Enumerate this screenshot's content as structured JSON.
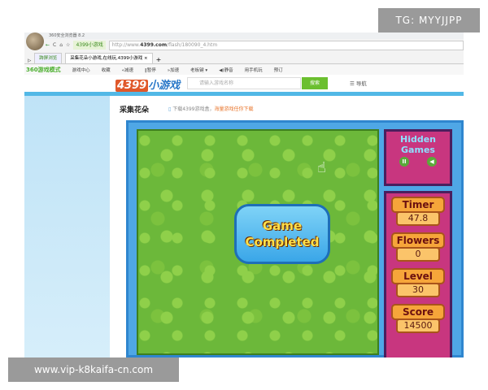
{
  "browser": {
    "title": "360安全浏览器 8.2",
    "url_prefix": "http://www.",
    "url_domain": "4399.com",
    "url_path": "/flash/180090_4.htm",
    "site_badge": "4399小游戏",
    "tabs": [
      {
        "label": "跨屏浏览"
      },
      {
        "label": "采集花朵小游戏,在线玩,4399小游戏 ×"
      },
      {
        "label": "+"
      }
    ],
    "toolbar": [
      "360游戏模式",
      "游戏中心",
      "收藏",
      "«减速",
      "‖暂停",
      "»加速",
      "老板键 ▾",
      "◀)静音",
      "用手机玩",
      "预订"
    ]
  },
  "site": {
    "logo_num": "4399",
    "logo_text": "小游戏",
    "search_placeholder": "请输入游戏名称",
    "search_button": "搜索",
    "nav": "☰ 导航"
  },
  "page": {
    "title": "采集花朵",
    "download_text": "下载4399游戏盒，",
    "download_highlight": "海量游戏任你下载"
  },
  "game": {
    "popup_line1": "Game",
    "popup_line2": "Completed",
    "logo_line1": "Hidden",
    "logo_line2": "Games",
    "stats": [
      {
        "label": "Timer",
        "value": "47.8"
      },
      {
        "label": "Flowers",
        "value": "0"
      },
      {
        "label": "Level",
        "value": "30"
      },
      {
        "label": "Score",
        "value": "14500"
      }
    ]
  },
  "watermarks": {
    "top": "TG: MYYJJPP",
    "bottom": "www.vip-k8kaifa-cn.com"
  }
}
